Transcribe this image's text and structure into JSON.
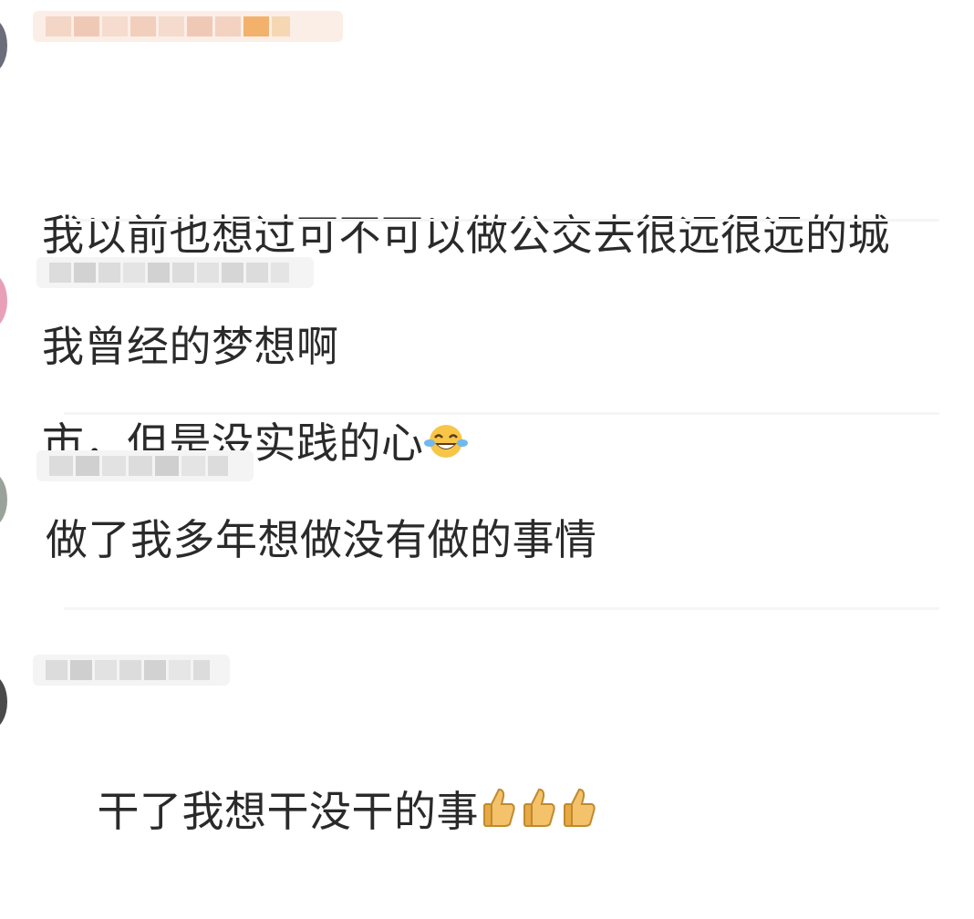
{
  "comments": [
    {
      "text_line1": "我以前也想过可不可以做公交去很远很远的城",
      "text_line2": "市，但是没实践的心",
      "emoji": "laugh-cry-emoji"
    },
    {
      "text": "我曾经的梦想啊"
    },
    {
      "text": "做了我多年想做没有做的事情"
    },
    {
      "text": "干了我想干没干的事",
      "emoji": "thumbs-up-emoji"
    }
  ],
  "colors": {
    "text": "#2a2a2a",
    "blur": "#dcdcdc",
    "blur_accent": "#f2b26b",
    "emoji_yellow": "#f7c548",
    "emoji_tear": "#6fb8f0"
  }
}
